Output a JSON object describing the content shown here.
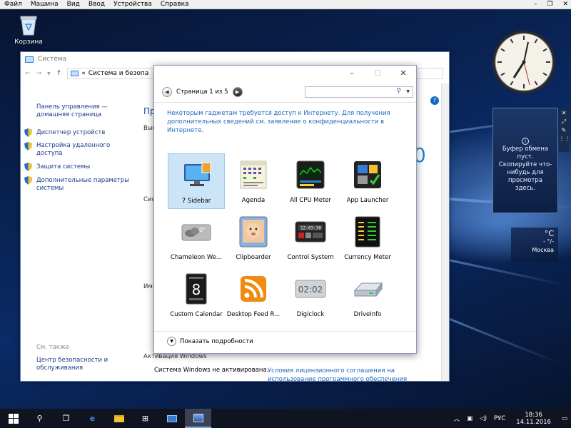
{
  "vm_menu": [
    "Файл",
    "Машина",
    "Вид",
    "Ввод",
    "Устройства",
    "Справка"
  ],
  "desktop": {
    "recycle_bin_label": "Корзина"
  },
  "system_window": {
    "title": "Система",
    "breadcrumb_prefix": "«",
    "breadcrumb": "Система и безопа",
    "left_nav": {
      "home": "Панель управления — домашняя страница",
      "items": [
        "Диспетчер устройств",
        "Настройка удаленного доступа",
        "Защита системы",
        "Дополнительные параметры системы"
      ],
      "see_also_title": "См. также",
      "see_also": [
        "Центр безопасности и обслуживания"
      ]
    },
    "main": {
      "heading_partial": "Про",
      "sec1_partial": "Вып",
      "sec2_partial": "Сист",
      "sec3_partial": "Имя",
      "big_digit": "0",
      "activation_title": "Активация Windows",
      "activation_status": "Система Windows не активирована.",
      "license_link": "Условия лицензионного соглашения на использование программного обеспечения"
    }
  },
  "gallery": {
    "page_label": "Страница 1 из 5",
    "notice": "Некоторым гаджетам требуется доступ к Интернету. Для получения дополнительных сведений см. заявление о конфиденциальности в Интернете.",
    "gadgets": [
      {
        "name": "7 Sidebar",
        "icon": "monitor-icon",
        "selected": true
      },
      {
        "name": "Agenda",
        "icon": "calendar-month-icon"
      },
      {
        "name": "All CPU Meter",
        "icon": "cpu-meter-icon"
      },
      {
        "name": "App Launcher",
        "icon": "app-launcher-icon"
      },
      {
        "name": "Chameleon We...",
        "icon": "weather-cloud-icon"
      },
      {
        "name": "Clipboarder",
        "icon": "baby-photo-icon"
      },
      {
        "name": "Control System",
        "icon": "control-system-icon"
      },
      {
        "name": "Currency Meter",
        "icon": "currency-table-icon"
      },
      {
        "name": "Custom Calendar",
        "icon": "date-calendar-icon"
      },
      {
        "name": "Desktop Feed R...",
        "icon": "rss-feed-icon"
      },
      {
        "name": "Digiclock",
        "icon": "digital-clock-icon"
      },
      {
        "name": "DriveInfo",
        "icon": "hard-drive-icon"
      }
    ],
    "details_label": "Показать подробности"
  },
  "clipboard_gadget": {
    "text": "Буфер обмена пуст. Скопируйте что-нибудь для просмотра здесь."
  },
  "weather_gadget": {
    "temp": "°C",
    "sub": "- °/-",
    "city": "Москва"
  },
  "tray": {
    "lang": "РУС",
    "time": "18:36",
    "date": "14.11.2016"
  }
}
